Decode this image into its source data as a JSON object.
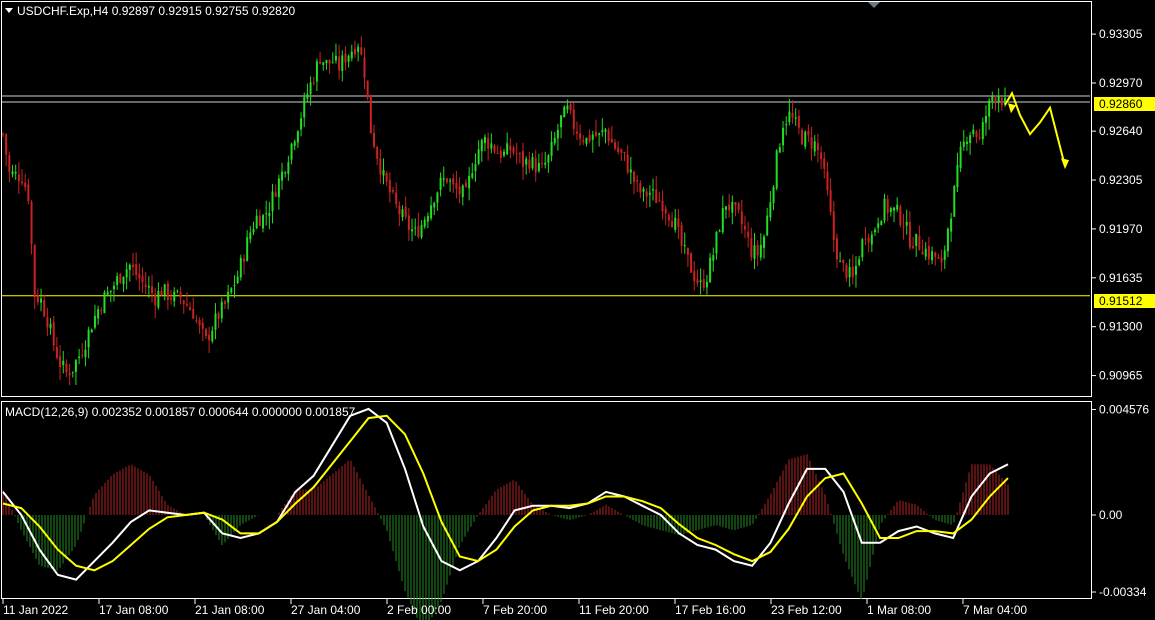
{
  "colors": {
    "background": "#000000",
    "frame": "#ffffff",
    "bull_candle": "#22dd22",
    "bear_candle": "#cc2222",
    "sr_line": "#ffff00",
    "price_line": "#cfcfcf",
    "arrow": "#ffff00",
    "macd_line": "#ffffff",
    "signal_line": "#ffff00",
    "hist_pos": "#b22222",
    "hist_neg": "#228b22",
    "price_label_bg": "#ffff00",
    "price_label_text": "#000000"
  },
  "header": {
    "icon": "triangle-down-icon",
    "text": "USDCHF.Exp,H4  0.92897 0.92915 0.92755 0.92820"
  },
  "macd_header": {
    "text": "MACD(12,26,9) 0.002352 0.001857 0.000644 0.000000 0.001857"
  },
  "scroll_marker_icon": "triangle-marker-icon",
  "price_axis": {
    "ticks": [
      "0.93305",
      "0.92970",
      "0.92640",
      "0.92305",
      "0.91970",
      "0.91635",
      "0.91300",
      "0.90965"
    ],
    "tick_values": [
      0.93305,
      0.9297,
      0.9264,
      0.92305,
      0.9197,
      0.91635,
      0.913,
      0.90965
    ],
    "range": [
      0.90825,
      0.93525
    ]
  },
  "macd_axis": {
    "ticks": [
      "0.004576",
      "0.00",
      "-0.00334"
    ],
    "tick_values": [
      0.004576,
      0.0,
      -0.00334
    ]
  },
  "level_labels": {
    "resistance": "0.92860",
    "support": "0.91512"
  },
  "time_axis": {
    "labels": [
      "11 Jan 2022",
      "17 Jan 08:00",
      "21 Jan 08:00",
      "27 Jan 04:00",
      "2 Feb 00:00",
      "7 Feb 20:00",
      "11 Feb 20:00",
      "17 Feb 16:00",
      "23 Feb 12:00",
      "1 Mar 08:00",
      "7 Mar 04:00"
    ]
  },
  "chart_data": [
    {
      "type": "candlestick",
      "symbol": "USDCHF.Exp",
      "timeframe": "H4",
      "ohlc_last": [
        0.92897,
        0.92915,
        0.92755,
        0.9282
      ],
      "levels": {
        "resistance": 0.9286,
        "support": 0.91512
      },
      "close_path": [
        0.9262,
        0.9235,
        0.9234,
        0.9233,
        0.922,
        0.9152,
        0.9148,
        0.9135,
        0.9118,
        0.9105,
        0.9098,
        0.9102,
        0.911,
        0.912,
        0.9132,
        0.9142,
        0.915,
        0.9155,
        0.9162,
        0.9168,
        0.9172,
        0.9166,
        0.916,
        0.9156,
        0.915,
        0.9155,
        0.9152,
        0.915,
        0.915,
        0.9145,
        0.914,
        0.9128,
        0.912,
        0.913,
        0.9138,
        0.9145,
        0.9155,
        0.9165,
        0.918,
        0.9195,
        0.9205,
        0.9205,
        0.9212,
        0.9225,
        0.9235,
        0.9248,
        0.9262,
        0.9275,
        0.929,
        0.9302,
        0.9315,
        0.931,
        0.9312,
        0.9308,
        0.9315,
        0.932,
        0.9325,
        0.9305,
        0.9265,
        0.9248,
        0.9232,
        0.9222,
        0.9212,
        0.9205,
        0.9198,
        0.9194,
        0.92,
        0.921,
        0.922,
        0.9228,
        0.9232,
        0.9225,
        0.9222,
        0.922,
        0.924,
        0.9252,
        0.9258,
        0.9255,
        0.925,
        0.9248,
        0.9252,
        0.9248,
        0.9242,
        0.9244,
        0.924,
        0.9238,
        0.9245,
        0.9258,
        0.9272,
        0.9278,
        0.9268,
        0.9262,
        0.9258,
        0.9262,
        0.926,
        0.9265,
        0.9256,
        0.925,
        0.9245,
        0.9235,
        0.9225,
        0.922,
        0.9222,
        0.9218,
        0.9215,
        0.9208,
        0.92,
        0.9185,
        0.9175,
        0.9165,
        0.9158,
        0.9165,
        0.918,
        0.92,
        0.9215,
        0.921,
        0.9205,
        0.9195,
        0.9182,
        0.918,
        0.9192,
        0.9218,
        0.9245,
        0.927,
        0.9275,
        0.9268,
        0.926,
        0.9258,
        0.9255,
        0.9245,
        0.922,
        0.919,
        0.9172,
        0.9168,
        0.9162,
        0.918,
        0.9195,
        0.9192,
        0.9205,
        0.9212,
        0.921,
        0.9208,
        0.9202,
        0.919,
        0.9188,
        0.9185,
        0.918,
        0.9178,
        0.917,
        0.9198,
        0.9222,
        0.9248,
        0.9262,
        0.9266,
        0.9258,
        0.9275,
        0.9288,
        0.929,
        0.9282
      ],
      "forecast_arrow_points": [
        0.9282,
        0.929,
        0.9275,
        0.9262,
        0.927,
        0.928,
        0.924
      ]
    },
    {
      "type": "line",
      "indicator": "MACD",
      "params": [
        12,
        26,
        9
      ],
      "values": {
        "main": 0.002352,
        "signal": 0.001857,
        "histogram": 0.000644,
        "extra_1": 0.0,
        "extra_2": 0.001857
      },
      "macd_path": [
        0.001,
        0.0,
        -0.0015,
        -0.0026,
        -0.0028,
        -0.002,
        -0.0012,
        -0.0003,
        0.0002,
        0.0001,
        0.0,
        0.0001,
        -0.0008,
        -0.001,
        -0.0008,
        -0.0003,
        0.001,
        0.0017,
        0.003,
        0.0043,
        0.0046,
        0.004,
        0.002,
        -0.0005,
        -0.002,
        -0.0024,
        -0.002,
        -0.001,
        0.0002,
        0.0004,
        0.0004,
        0.0003,
        0.0005,
        0.001,
        0.0008,
        0.0004,
        0.0,
        -0.0008,
        -0.0013,
        -0.0015,
        -0.002,
        -0.0022,
        -0.0012,
        0.0005,
        0.002,
        0.002,
        0.001,
        -0.0012,
        -0.0012,
        -0.0007,
        -0.0005,
        -0.0008,
        -0.001,
        0.0008,
        0.0018,
        0.0022
      ],
      "signal_path": [
        0.0005,
        0.0003,
        -0.0005,
        -0.0015,
        -0.0022,
        -0.0024,
        -0.002,
        -0.0013,
        -0.0006,
        -0.0001,
        0.0,
        0.0001,
        -0.0002,
        -0.0008,
        -0.0008,
        -0.0003,
        0.0005,
        0.0012,
        0.0022,
        0.0032,
        0.0042,
        0.0043,
        0.0035,
        0.0018,
        -0.0003,
        -0.0018,
        -0.002,
        -0.0015,
        -0.0005,
        0.0002,
        0.0004,
        0.0004,
        0.0005,
        0.0008,
        0.0008,
        0.0006,
        0.0003,
        -0.0004,
        -0.001,
        -0.0013,
        -0.0017,
        -0.002,
        -0.0016,
        -0.0006,
        0.0008,
        0.0016,
        0.0018,
        0.0005,
        -0.001,
        -0.001,
        -0.0007,
        -0.0007,
        -0.0008,
        -0.0002,
        0.0008,
        0.0016
      ]
    }
  ]
}
